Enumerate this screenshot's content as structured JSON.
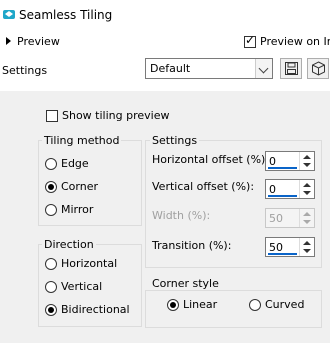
{
  "window": {
    "title": "Seamless Tiling",
    "title_icon": "seamless-tiling-app-icon"
  },
  "preview": {
    "expand_label": "Preview",
    "on_image_label": "Preview on Im",
    "on_image_checked": true
  },
  "settings": {
    "label": "Settings",
    "preset_value": "Default",
    "save_icon": "floppy-disk-icon",
    "reset_icon": "cube-icon"
  },
  "show_tiling_preview": {
    "label": "Show tiling preview",
    "checked": false
  },
  "tiling_method": {
    "title": "Tiling method",
    "options": [
      {
        "label": "Edge",
        "selected": false
      },
      {
        "label": "Corner",
        "selected": true
      },
      {
        "label": "Mirror",
        "selected": false
      }
    ]
  },
  "direction": {
    "title": "Direction",
    "options": [
      {
        "label": "Horizontal",
        "selected": false
      },
      {
        "label": "Vertical",
        "selected": false
      },
      {
        "label": "Bidirectional",
        "selected": true
      }
    ]
  },
  "settings_group": {
    "title": "Settings",
    "horizontal_offset": {
      "label": "Horizontal offset (%):",
      "value": "0",
      "fill_fraction": 0.95
    },
    "vertical_offset": {
      "label": "Vertical offset (%):",
      "value": "0",
      "fill_fraction": 0.95
    },
    "width": {
      "label": "Width (%):",
      "value": "50",
      "disabled": true
    },
    "transition": {
      "label": "Transition (%):",
      "value": "50",
      "fill_fraction": 0.95
    }
  },
  "corner_style": {
    "title": "Corner style",
    "options": [
      {
        "label": "Linear",
        "selected": true
      },
      {
        "label": "Curved",
        "selected": false
      }
    ]
  },
  "colors": {
    "accent": "#0a64c8",
    "panel": "#f0f0f0",
    "icon_teal": "#1fa7c9"
  }
}
